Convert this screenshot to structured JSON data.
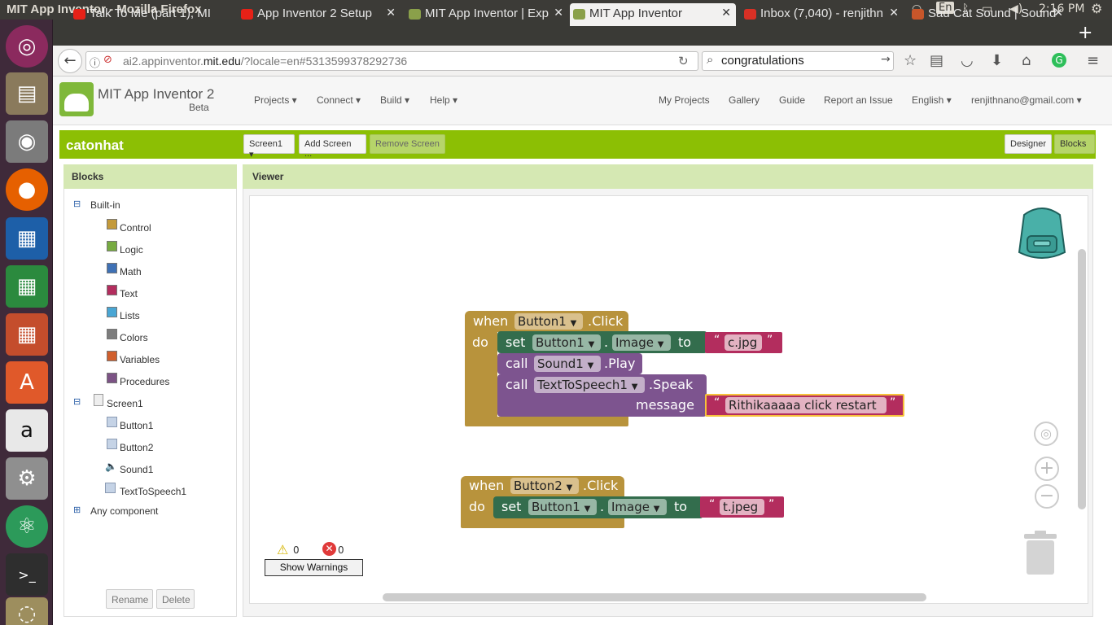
{
  "os": {
    "window_title": "MIT App Inventor - Mozilla Firefox",
    "keyboard": "En",
    "clock": "2:16 PM"
  },
  "tabs": [
    {
      "label": "Talk To Me (part 1), MI",
      "icon": "youtube-icon"
    },
    {
      "label": "App Inventor 2 Setup",
      "icon": "youtube-icon"
    },
    {
      "label": "MIT App Inventor | Exp",
      "icon": "appinventor-icon"
    },
    {
      "label": "MIT App Inventor",
      "icon": "appinventor-icon"
    },
    {
      "label": "Inbox (7,040) - renjithn",
      "icon": "gmail-icon"
    },
    {
      "label": "Sad Cat Sound | Sound",
      "icon": "soundbible-icon"
    }
  ],
  "browser": {
    "url_prefix": "ai2.appinventor.",
    "url_domain": "mit.edu",
    "url_suffix": "/?locale=en#5313599378292736",
    "search_value": "congratulations"
  },
  "app": {
    "name": "MIT App Inventor 2",
    "beta": "Beta",
    "menus": [
      "Projects ▾",
      "Connect ▾",
      "Build ▾",
      "Help ▾"
    ],
    "links": [
      "My Projects",
      "Gallery",
      "Guide",
      "Report an Issue",
      "English ▾",
      "renjithnano@gmail.com ▾"
    ]
  },
  "project": {
    "name": "catonhat",
    "screen_select": "Screen1 ▾",
    "add_screen": "Add Screen ...",
    "remove_screen": "Remove Screen",
    "designer": "Designer",
    "blocks": "Blocks"
  },
  "blocks_panel": {
    "title": "Blocks",
    "builtin": "Built-in",
    "builtin_items": [
      {
        "label": "Control",
        "color": "#c49a3a"
      },
      {
        "label": "Logic",
        "color": "#77ab41"
      },
      {
        "label": "Math",
        "color": "#3f71b5"
      },
      {
        "label": "Text",
        "color": "#b32d5e"
      },
      {
        "label": "Lists",
        "color": "#49a6d4"
      },
      {
        "label": "Colors",
        "color": "#7d7d7d"
      },
      {
        "label": "Variables",
        "color": "#d05f2d"
      },
      {
        "label": "Procedures",
        "color": "#7c5385"
      }
    ],
    "screen": "Screen1",
    "components": [
      "Button1",
      "Button2",
      "Sound1",
      "TextToSpeech1"
    ],
    "any_component": "Any component",
    "rename": "Rename",
    "delete": "Delete"
  },
  "viewer": {
    "title": "Viewer",
    "warnings_count": "0",
    "errors_count": "0",
    "show_warnings": "Show Warnings"
  },
  "block1": {
    "when": "when",
    "component": "Button1",
    "event": ".Click",
    "do": "do",
    "set": "set",
    "set_component": "Button1",
    "dot": ".",
    "property": "Image",
    "to": "to",
    "image_value": "c.jpg",
    "call": "call",
    "sound": "Sound1",
    "play": ".Play",
    "call2": "call",
    "tts": "TextToSpeech1",
    "speak": ".Speak",
    "message": "message",
    "message_value": "Rithikaaaaa  click restart"
  },
  "block2": {
    "when": "when",
    "component": "Button2",
    "event": ".Click",
    "do": "do",
    "set": "set",
    "set_component": "Button1",
    "dot": ".",
    "property": "Image",
    "to": "to",
    "image_value": "t.jpeg"
  }
}
